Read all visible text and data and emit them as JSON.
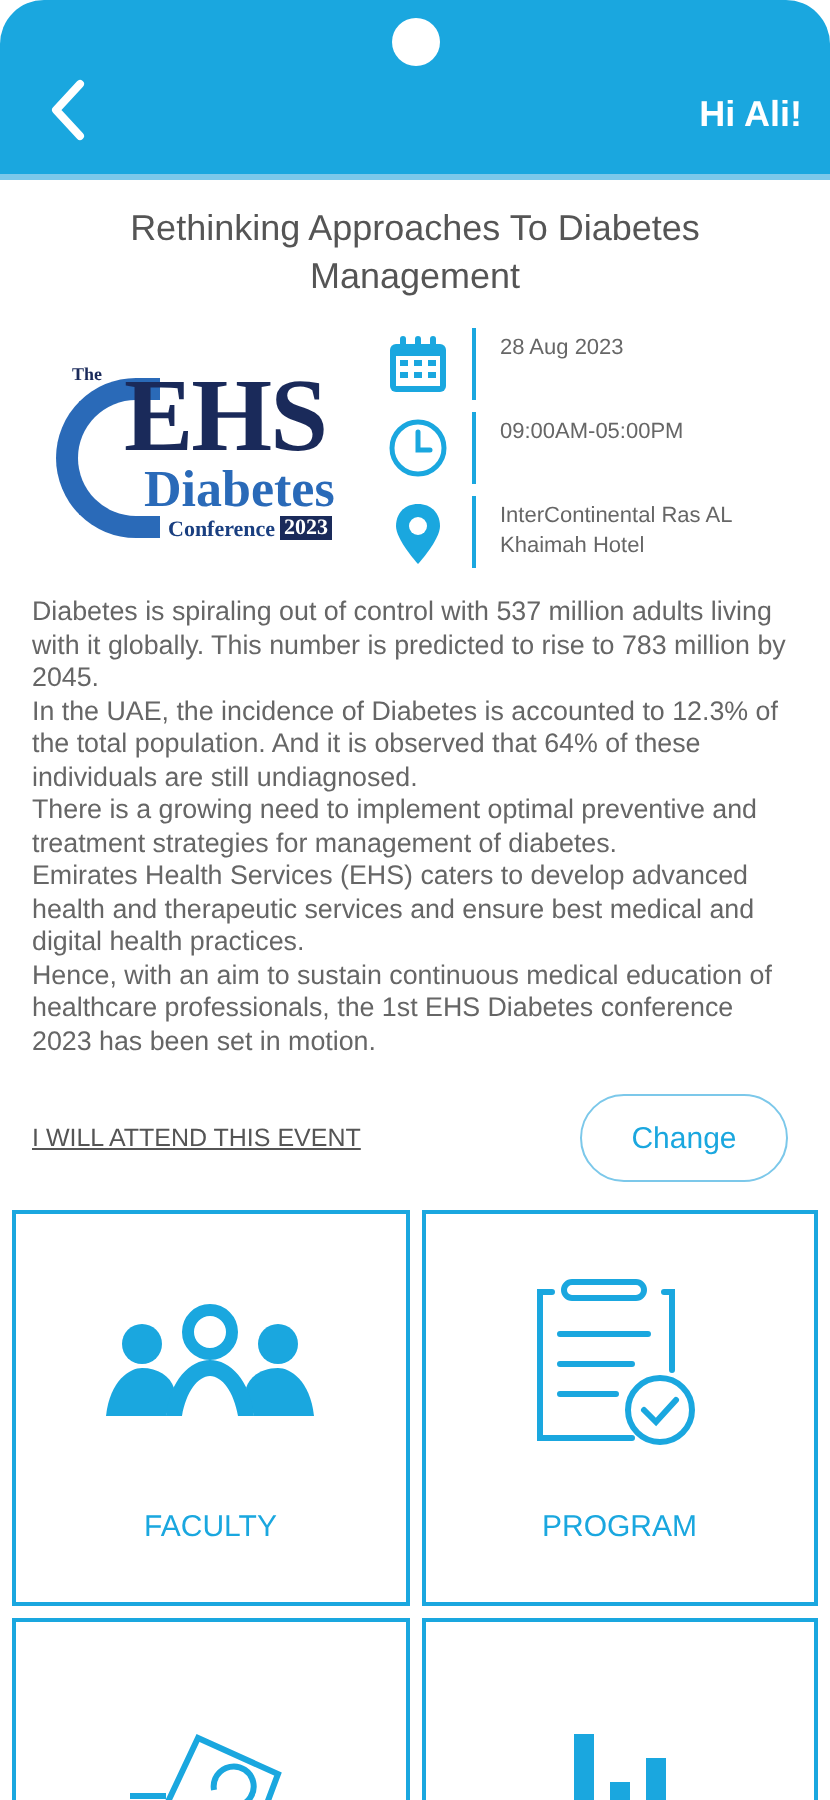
{
  "header": {
    "greeting": "Hi Ali!"
  },
  "event": {
    "title": "Rethinking Approaches To Diabetes Management",
    "logo": {
      "small": "The",
      "main": "EHS",
      "sub": "Diabetes",
      "tag": "Conference",
      "year": "2023"
    },
    "details": [
      {
        "text": "28 Aug 2023"
      },
      {
        "text": "09:00AM-05:00PM"
      },
      {
        "text": "InterContinental Ras AL Khaimah Hotel"
      }
    ],
    "description": [
      "Diabetes is spiraling out of control with 537 million adults living with it globally. This number is predicted to rise to 783 million by 2045.",
      "In the UAE, the incidence of Diabetes is accounted to 12.3% of the total population. And it is observed that 64% of these individuals are still undiagnosed.",
      "There is a growing need to implement optimal preventive and treatment strategies for management of diabetes.",
      "Emirates Health Services (EHS) caters to develop advanced health and therapeutic services and ensure best medical and digital health practices.",
      "Hence, with an aim to sustain continuous medical education of healthcare professionals, the 1st EHS Diabetes conference 2023 has been set in motion."
    ]
  },
  "attendance": {
    "status": "I WILL ATTEND THIS EVENT",
    "button": "Change"
  },
  "tiles": [
    {
      "kind": "labeled",
      "label": "FACULTY"
    },
    {
      "kind": "labeled",
      "label": "PROGRAM"
    },
    {
      "kind": "cut_off"
    },
    {
      "kind": "cut_off"
    }
  ]
}
